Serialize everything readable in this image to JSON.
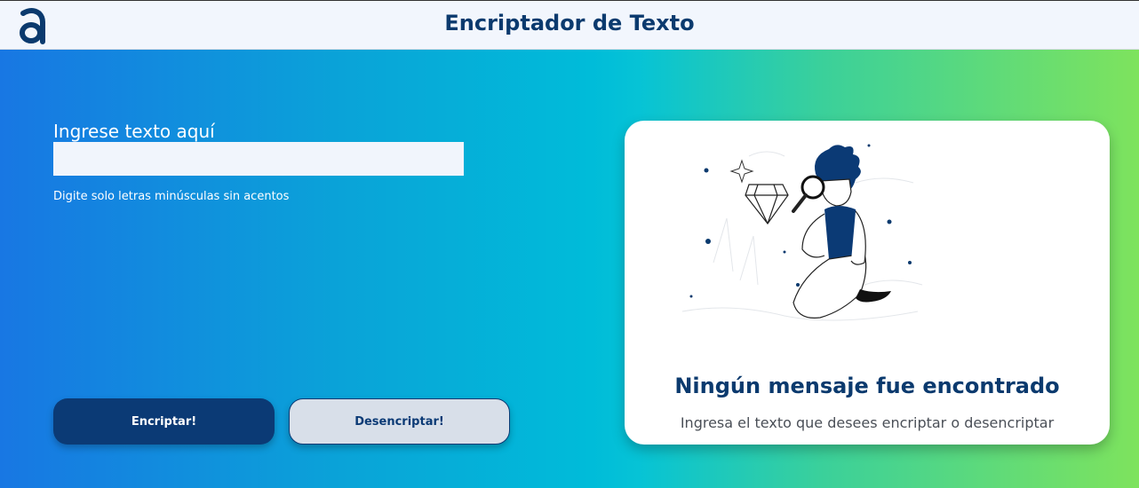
{
  "header": {
    "title": "Encriptador de Texto",
    "logo_icon": "alura-a-logo"
  },
  "input_section": {
    "label": "Ingrese texto aquí",
    "value": "",
    "hint": "Digite solo letras minúsculas sin acentos"
  },
  "buttons": {
    "encrypt_label": "Encriptar!",
    "decrypt_label": "Desencriptar!"
  },
  "result": {
    "illustration": "person-with-magnifying-glass-illustration",
    "title": "Ningún mensaje fue encontrado",
    "subtitle": "Ingresa el texto que desees encriptar o desencriptar"
  },
  "colors": {
    "brand_dark": "#0b3a75",
    "header_bg": "#f2f6fd",
    "gradient_start": "#1877e3",
    "gradient_mid": "#00bcd9",
    "gradient_end": "#7ee35d"
  }
}
